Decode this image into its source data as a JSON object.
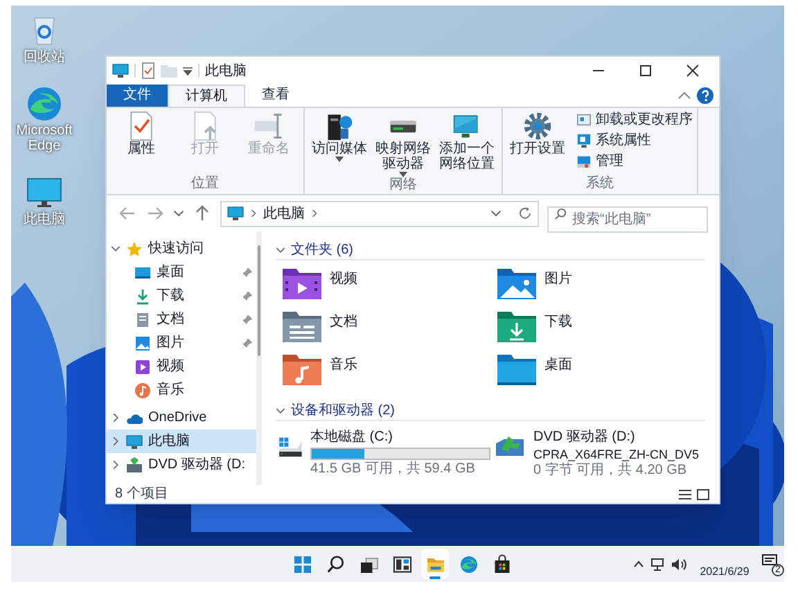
{
  "desktop_icons": [
    {
      "kind": "recycle",
      "label": "回收站"
    },
    {
      "kind": "edge",
      "label": "Microsoft Edge"
    },
    {
      "kind": "pc",
      "label": "此电脑"
    }
  ],
  "window": {
    "title": "此电脑",
    "tabs": [
      {
        "label": "文件",
        "kind": "file",
        "selected": false
      },
      {
        "label": "计算机",
        "kind": "plain",
        "selected": true
      },
      {
        "label": "查看",
        "kind": "plain",
        "selected": false
      }
    ],
    "ribbon_groups": [
      {
        "label": "位置",
        "buttons": [
          {
            "kind": "properties",
            "label": "属性",
            "disabled": false,
            "dropdown": false
          },
          {
            "kind": "open",
            "label": "打开",
            "disabled": true,
            "dropdown": false
          },
          {
            "kind": "rename",
            "label": "重命名",
            "disabled": true,
            "dropdown": false
          }
        ]
      },
      {
        "label": "网络",
        "buttons": [
          {
            "kind": "media",
            "label": "访问媒体",
            "disabled": false,
            "dropdown": true
          },
          {
            "kind": "map_drive",
            "label": "映射网络驱动器",
            "disabled": false,
            "dropdown": true
          },
          {
            "kind": "network_location",
            "label": "添加一个网络位置",
            "disabled": false,
            "dropdown": false
          }
        ]
      },
      {
        "label": "系统",
        "buttons": [
          {
            "kind": "settings",
            "label": "打开设置",
            "disabled": false,
            "dropdown": false
          }
        ],
        "small_buttons": [
          {
            "kind": "uninstall",
            "label": "卸载或更改程序"
          },
          {
            "kind": "system_properties",
            "label": "系统属性"
          },
          {
            "kind": "manage",
            "label": "管理"
          }
        ]
      }
    ],
    "address": {
      "location": "此电脑"
    },
    "search": {
      "placeholder": "搜索“此电脑”"
    },
    "sidebar": [
      {
        "kind": "quick_access",
        "label": "快速访问",
        "expanded": true,
        "selected": false,
        "children": [
          {
            "kind": "desktop",
            "label": "桌面",
            "pinned": true,
            "selected": false
          },
          {
            "kind": "downloads",
            "label": "下载",
            "pinned": true,
            "selected": false
          },
          {
            "kind": "documents",
            "label": "文档",
            "pinned": true,
            "selected": false
          },
          {
            "kind": "pictures",
            "label": "图片",
            "pinned": true,
            "selected": false
          },
          {
            "kind": "videos",
            "label": "视频",
            "pinned": false,
            "selected": false
          },
          {
            "kind": "music",
            "label": "音乐",
            "pinned": false,
            "selected": false
          }
        ]
      },
      {
        "kind": "onedrive",
        "label": "OneDrive",
        "expanded": false,
        "selected": false
      },
      {
        "kind": "pc",
        "label": "此电脑",
        "expanded": false,
        "selected": true
      },
      {
        "kind": "dvd",
        "label": "DVD 驱动器 (D:",
        "expanded": false,
        "selected": false
      }
    ],
    "folders": {
      "heading": "文件夹 (6)",
      "expanded": true,
      "items": [
        {
          "kind": "videos",
          "label": "视频"
        },
        {
          "kind": "pictures",
          "label": "图片"
        },
        {
          "kind": "documents",
          "label": "文档"
        },
        {
          "kind": "downloads",
          "label": "下载"
        },
        {
          "kind": "music",
          "label": "音乐"
        },
        {
          "kind": "desktop",
          "label": "桌面"
        }
      ]
    },
    "drives": {
      "heading": "设备和驱动器 (2)",
      "expanded": true,
      "items": [
        {
          "kind": "disk",
          "label": "本地磁盘 (C:)",
          "level": 0.3,
          "caption": "41.5 GB 可用，共 59.4 GB"
        },
        {
          "kind": "dvd",
          "label": "DVD 驱动器 (D:)",
          "volume": "CPRA_X64FRE_ZH-CN_DV5",
          "caption": "0 字节 可用，共 4.20 GB"
        }
      ]
    },
    "status_bar": {
      "item_count": "8 个项目"
    }
  },
  "taskbar": {
    "apps": [
      {
        "kind": "start",
        "selected": false
      },
      {
        "kind": "search",
        "selected": false
      },
      {
        "kind": "task_view",
        "selected": false
      },
      {
        "kind": "widgets",
        "selected": false
      },
      {
        "kind": "explorer",
        "selected": true
      },
      {
        "kind": "edge",
        "selected": false
      },
      {
        "kind": "store",
        "selected": false
      }
    ],
    "tray": {
      "date": "2021/6/29",
      "notification_count": "2"
    }
  }
}
